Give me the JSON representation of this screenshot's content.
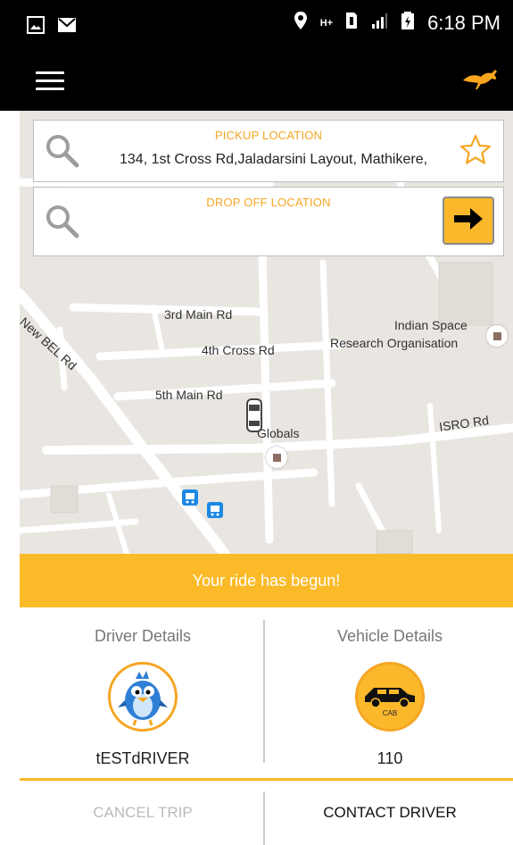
{
  "status_bar": {
    "time": "6:18 PM",
    "network": "H+"
  },
  "pickup": {
    "title": "PICKUP LOCATION",
    "value": "134, 1st Cross Rd,Jaladarsini Layout, Mathikere,"
  },
  "dropoff": {
    "title": "DROP OFF LOCATION",
    "value": ""
  },
  "map": {
    "labels": [
      "New BEL Rd",
      "3rd Main Rd",
      "4th Cross Rd",
      "5th Main Rd",
      "Indian Space",
      "Research Organisation",
      "Globals",
      "ISRO Rd"
    ]
  },
  "banner": "Your ride has begun!",
  "driver": {
    "heading": "Driver Details",
    "name": "tESTdRIVER"
  },
  "vehicle": {
    "heading": "Vehicle Details",
    "number": "110",
    "badge": "CAB"
  },
  "actions": {
    "cancel": "CANCEL TRIP",
    "contact": "CONTACT DRIVER"
  },
  "colors": {
    "accent": "#fbbb29",
    "title_orange": "#f5a623"
  },
  "icons": [
    "image-icon",
    "mail-icon",
    "location-pin-icon",
    "signal-icon",
    "battery-icon",
    "menu-icon",
    "kangaroo-logo-icon",
    "search-icon",
    "star-icon",
    "arrow-right-icon",
    "car-marker-icon",
    "bus-stop-icon"
  ]
}
